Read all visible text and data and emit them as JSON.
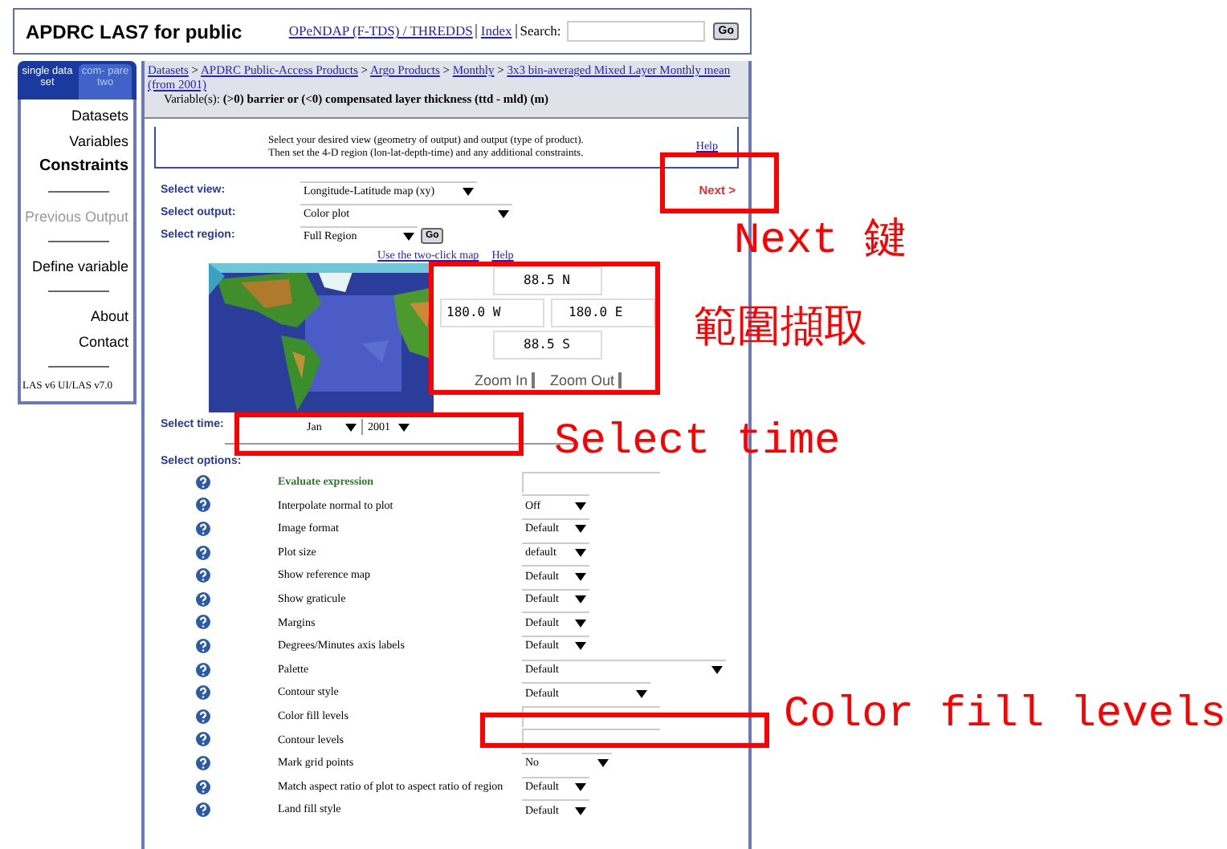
{
  "header": {
    "title": "APDRC LAS7 for public",
    "links": [
      "OPeNDAP (F-TDS) / THREDDS",
      "Index"
    ],
    "search_label": "Search:",
    "search_button": "Go"
  },
  "sidebar": {
    "tabs": [
      {
        "label": "single data set",
        "selected": true
      },
      {
        "label": "com- pare two",
        "selected": false
      }
    ],
    "groups": [
      [
        {
          "label": "Datasets",
          "selected": false,
          "disabled": false
        },
        {
          "label": "Variables",
          "selected": false,
          "disabled": false
        },
        {
          "label": "Constraints",
          "selected": true,
          "disabled": false
        }
      ],
      [
        {
          "label": "Previous Output",
          "selected": false,
          "disabled": true
        }
      ],
      [
        {
          "label": "Define variable",
          "selected": false,
          "disabled": false
        }
      ],
      [
        {
          "label": "About",
          "selected": false,
          "disabled": false
        },
        {
          "label": "Contact",
          "selected": false,
          "disabled": false
        }
      ]
    ],
    "footer": "LAS v6 UI/LAS v7.0"
  },
  "breadcrumb": {
    "separator": ">",
    "links": [
      "Datasets",
      "APDRC Public-Access Products",
      "Argo Products",
      "Monthly",
      "3x3 bin-averaged Mixed Layer Monthly mean (from 2001)"
    ],
    "variable_label": "Variable(s):",
    "variable": "(>0) barrier or (<0) compensated layer thickness (ttd - mld) (m)"
  },
  "info": {
    "lines": [
      "Select your desired view (geometry of output) and output (type of product).",
      "Then set the 4-D region (lon-lat-depth-time) and any additional constraints."
    ],
    "help": "Help"
  },
  "next": "Next >",
  "view": {
    "label": "Select view:",
    "value": "Longitude-Latitude map (xy)"
  },
  "output": {
    "label": "Select output:",
    "value": "Color plot"
  },
  "region": {
    "label": "Select region:",
    "value": "Full Region",
    "button": "Go"
  },
  "map": {
    "links": [
      "Use the two-click map",
      "Help"
    ],
    "north": "88.5 N",
    "west": "180.0 W",
    "east": "180.0 E",
    "south": "88.5 S",
    "buttons": [
      "Zoom In",
      "Zoom Out"
    ]
  },
  "time": {
    "label": "Select time:",
    "month": "Jan",
    "year": "2001"
  },
  "options": {
    "label": "Select options:",
    "rows": [
      {
        "label": "Evaluate expression",
        "kind": "input",
        "emphasized": true
      },
      {
        "label": "Interpolate normal to plot",
        "kind": "select",
        "emphasized": false,
        "value": "Off"
      },
      {
        "label": "Image format",
        "kind": "select",
        "emphasized": false,
        "value": "Default"
      },
      {
        "label": "Plot size",
        "kind": "select",
        "emphasized": false,
        "value": "default"
      },
      {
        "label": "Show reference map",
        "kind": "select",
        "emphasized": false,
        "value": "Default"
      },
      {
        "label": "Show graticule",
        "kind": "select",
        "emphasized": false,
        "value": "Default"
      },
      {
        "label": "Margins",
        "kind": "select",
        "emphasized": false,
        "value": "Default"
      },
      {
        "label": "Degrees/Minutes axis labels",
        "kind": "select",
        "emphasized": false,
        "value": "Default"
      },
      {
        "label": "Palette",
        "kind": "select",
        "emphasized": false,
        "value": "Default"
      },
      {
        "label": "Contour style",
        "kind": "select",
        "emphasized": false,
        "value": "Default"
      },
      {
        "label": "Color fill levels",
        "kind": "input",
        "emphasized": false
      },
      {
        "label": "Contour levels",
        "kind": "input",
        "emphasized": false
      },
      {
        "label": "Mark grid points",
        "kind": "select",
        "emphasized": false,
        "value": "No"
      },
      {
        "label": "Match aspect ratio of plot to aspect ratio of region",
        "kind": "select",
        "emphasized": false,
        "value": "Default"
      },
      {
        "label": "Land fill style",
        "kind": "select",
        "emphasized": false,
        "value": "Default"
      }
    ]
  },
  "annotations": [
    {
      "text": "Next 鍵"
    },
    {
      "text": "範圍擷取"
    },
    {
      "text": "Select time"
    },
    {
      "text": "Color fill levels"
    }
  ]
}
